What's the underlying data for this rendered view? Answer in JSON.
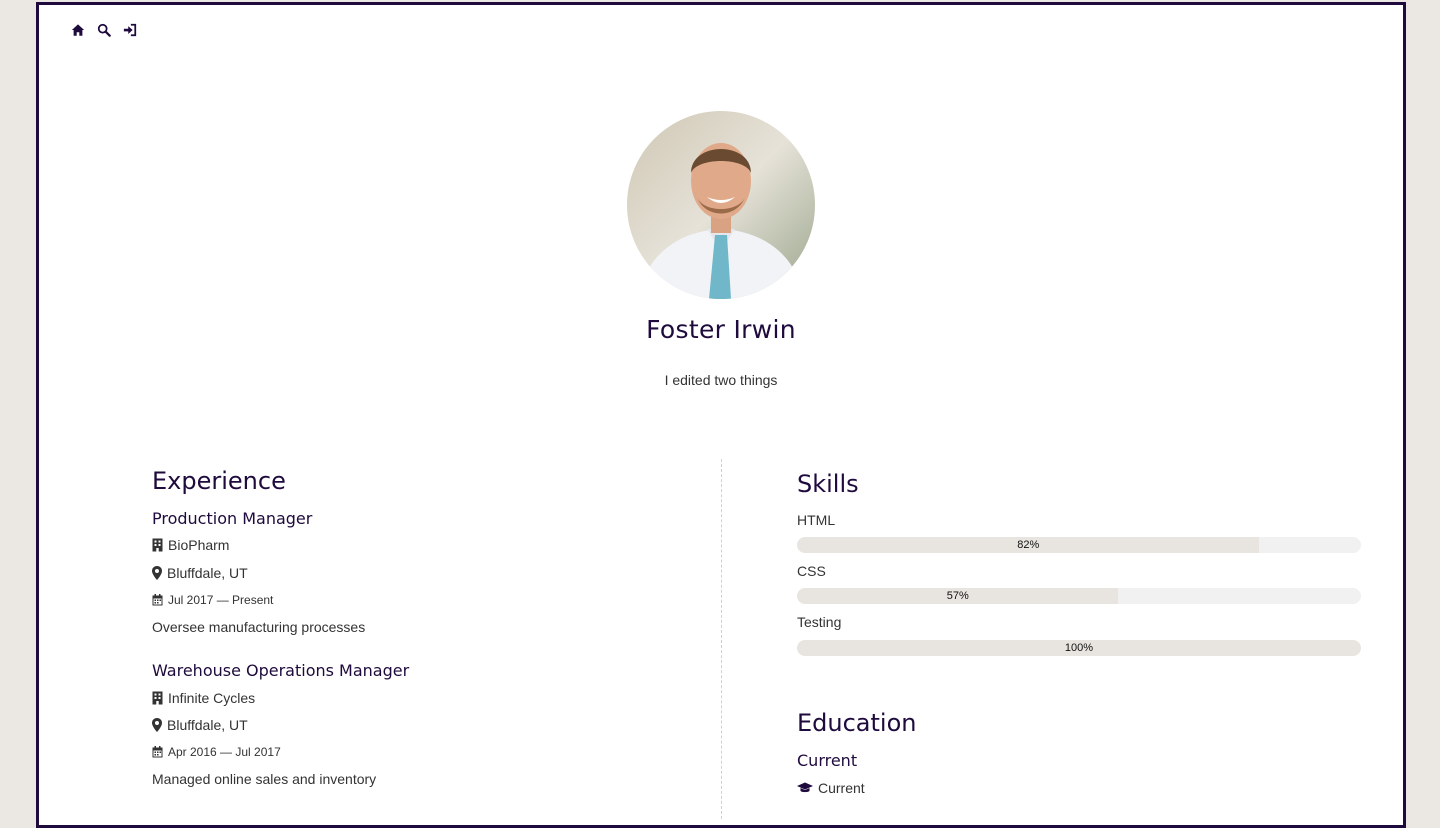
{
  "nav": {
    "icons": [
      "home-icon",
      "search-icon",
      "sign-in-icon"
    ]
  },
  "profile": {
    "name": "Foster Irwin",
    "bio": "I edited two things"
  },
  "experience": {
    "title": "Experience",
    "jobs": [
      {
        "title": "Production Manager",
        "company": "BioPharm",
        "location": "Bluffdale, UT",
        "dates": "Jul 2017 — Present",
        "description": "Oversee manufacturing processes"
      },
      {
        "title": "Warehouse Operations Manager",
        "company": "Infinite Cycles",
        "location": "Bluffdale, UT",
        "dates": "Apr 2016 — Jul 2017",
        "description": "Managed online sales and inventory"
      }
    ]
  },
  "skills": {
    "title": "Skills",
    "items": [
      {
        "name": "HTML",
        "percent": 82,
        "label": "82%"
      },
      {
        "name": "CSS",
        "percent": 57,
        "label": "57%"
      },
      {
        "name": "Testing",
        "percent": 100,
        "label": "100%"
      }
    ]
  },
  "education": {
    "title": "Education",
    "items": [
      {
        "title": "Current",
        "detail": "Current"
      }
    ]
  },
  "colors": {
    "accent": "#1e0a3c",
    "page_bg": "#ebe7e3",
    "bar_fill": "#e8e4e0",
    "bar_track": "#f1f1f1"
  }
}
